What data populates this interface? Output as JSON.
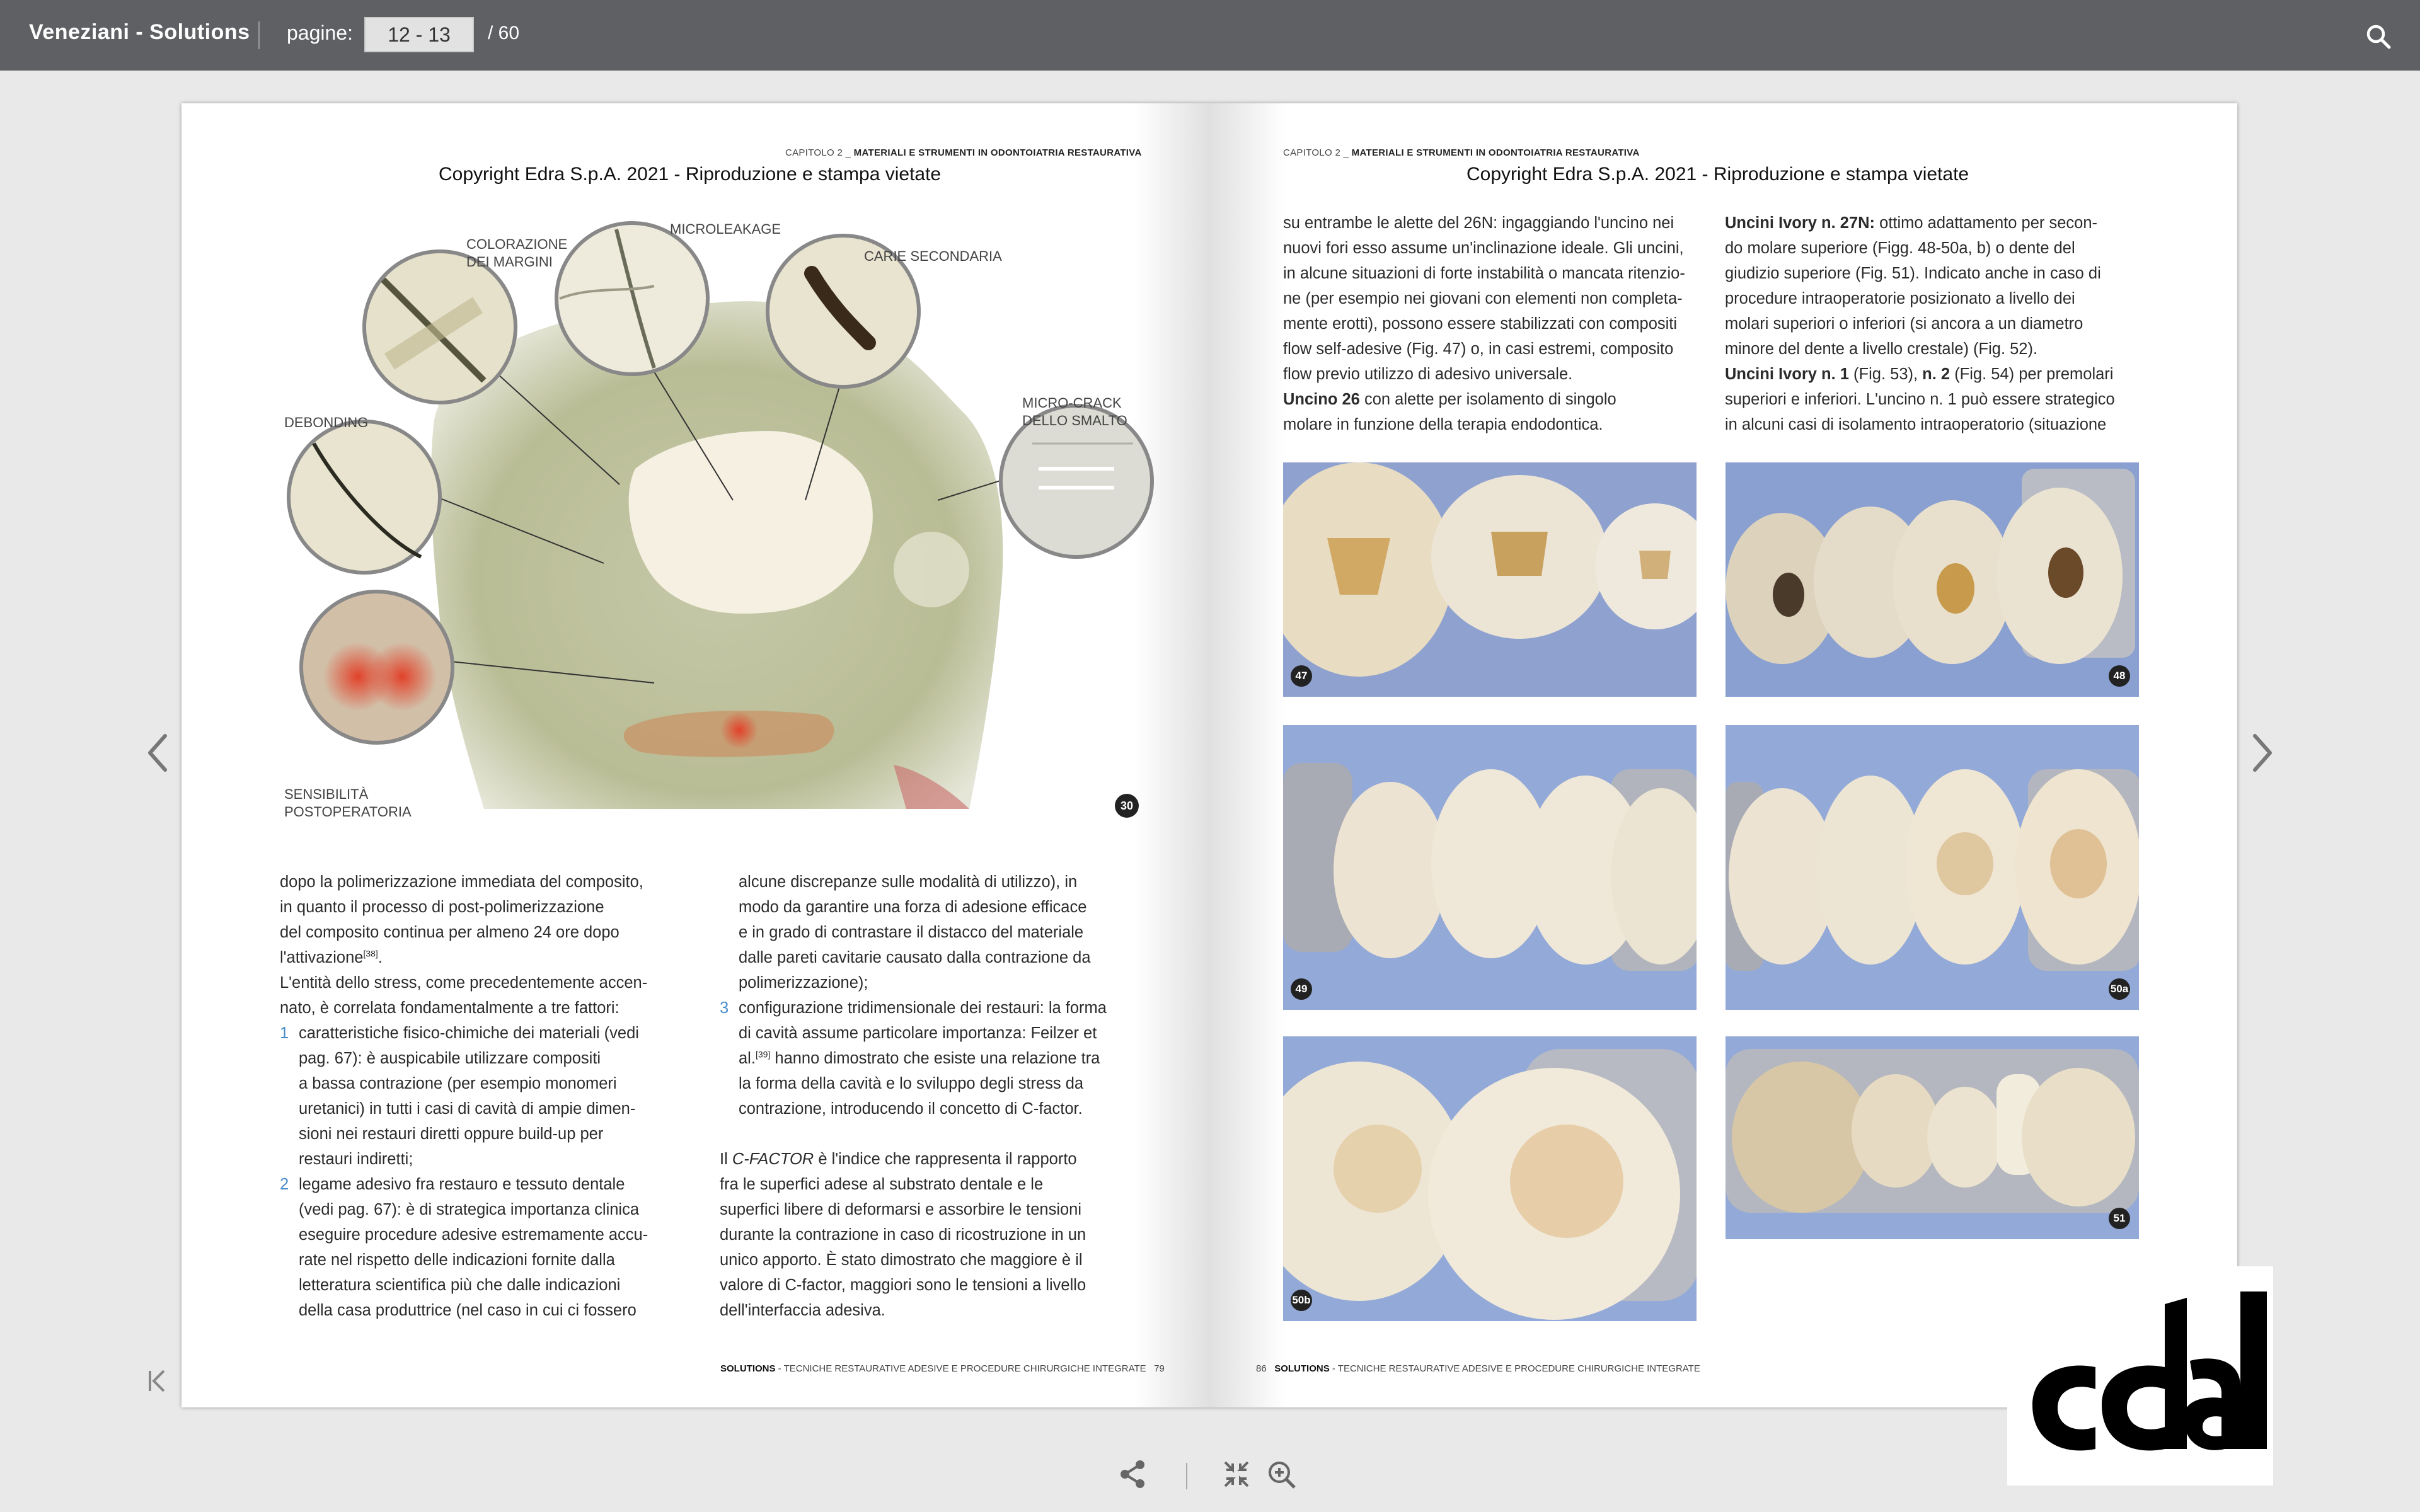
{
  "header": {
    "app_title": "Veneziani - Solutions",
    "pages_label": "pagine:",
    "page_value": "12 - 13",
    "page_total": "/  60"
  },
  "icons": {
    "search": "search-icon",
    "prev": "chevron-left-icon",
    "next": "chevron-right-icon",
    "first": "first-page-icon",
    "share": "share-icon",
    "shrink": "collapse-icon",
    "zoom": "zoom-in-icon"
  },
  "left_page": {
    "running_head_prefix": "CAPITOLO 2 _ ",
    "running_head": "MATERIALI E STRUMENTI IN ODONTOIATRIA RESTAURATIVA",
    "copyright": "Copyright Edra S.p.A. 2021 - Riproduzione e stampa vietate",
    "figure": {
      "labels": {
        "colorazione": "COLORAZIONE\nDEI MARGINI",
        "microleakage": "MICROLEAKAGE",
        "carie": "CARIE SECONDARIA",
        "debonding": "DEBONDING",
        "microcrack": "MICRO-CRACK\nDELLO SMALTO",
        "sensibilita": "SENSIBILITÀ\nPOSTOPERATORIA"
      },
      "number": "30"
    },
    "col1": [
      "dopo la polimerizzazione immediata del composito,",
      "in quanto il processo di post-polimerizzazione",
      "del composito continua per almeno 24 ore dopo",
      "l'attivazione",
      "L'entità dello stress, come precedentemente accen-",
      "nato, è correlata fondamentalmente a tre fattori:"
    ],
    "ref38": "[38]",
    "item1_num": "1",
    "item1": [
      "caratteristiche fisico-chimiche dei materiali (vedi",
      "pag. 67): è auspicabile utilizzare compositi",
      "a bassa contrazione (per esempio monomeri",
      "uretanici) in tutti i casi di cavità di ampie dimen-",
      "sioni nei restauri diretti oppure build-up per",
      "restauri indiretti;"
    ],
    "item2_num": "2",
    "item2": [
      "legame adesivo fra restauro e tessuto dentale",
      "(vedi pag. 67): è di strategica importanza clinica",
      "eseguire procedure adesive estremamente accu-",
      "rate nel rispetto delle indicazioni fornite dalla",
      "letteratura scientifica più che dalle indicazioni",
      "della casa produttrice (nel caso in cui ci fossero"
    ],
    "col2_cont": [
      "alcune discrepanze sulle modalità di utilizzo), in",
      "modo da garantire una forza di adesione efficace",
      "e in grado di contrastare il distacco del materiale",
      "dalle pareti cavitarie causato dalla contrazione da",
      "polimerizzazione);"
    ],
    "item3_num": "3",
    "item3": [
      "configurazione tridimensionale dei restauri: la forma",
      "di cavità assume particolare importanza: Feilzer et",
      "hanno dimostrato che esiste una relazione tra",
      "la forma della cavità e lo sviluppo degli stress da",
      "contrazione, introducendo il concetto di C-factor."
    ],
    "item3_al": "al.",
    "ref39": "[39]",
    "cfactor_pre": "Il ",
    "cfactor_term": "C-FACTOR",
    "cfactor_post": " è l'indice che rappresenta il rapporto",
    "cfactor": [
      "fra le superfici adese al substrato dentale e le",
      "superfici libere di deformarsi e assorbire le tensioni",
      "durante la contrazione in caso di ricostruzione in un",
      "unico apporto. È stato dimostrato che maggiore è il",
      "valore di C-factor, maggiori sono le tensioni a livello",
      "dell'interfaccia adesiva."
    ],
    "footer_brand": "SOLUTIONS",
    "footer_text": " - TECNICHE RESTAURATIVE ADESIVE E PROCEDURE CHIRURGICHE INTEGRATE",
    "footer_page": "79"
  },
  "right_page": {
    "running_head_prefix": "CAPITOLO 2 _ ",
    "running_head": "MATERIALI E STRUMENTI IN ODONTOIATRIA RESTAURATIVA",
    "copyright": "Copyright Edra S.p.A. 2021 - Riproduzione e stampa vietate",
    "col1": [
      "su entrambe le alette del 26N: ingaggiando l'uncino nei",
      "nuovi fori esso assume un'inclinazione ideale. Gli uncini,",
      "in alcune situazioni di forte instabilità o mancata ritenzio-",
      "ne (per esempio nei giovani con elementi non completa-",
      "mente erotti), possono essere stabilizzati con compositi",
      "flow self-adesive (Fig. 47) o, in casi estremi, composito",
      "flow previo utilizzo di adesivo universale."
    ],
    "uncino26_bold": "Uncino 26",
    "uncino26_rest": " con alette per isolamento di singolo",
    "uncino26_line2": "molare in funzione della terapia endodontica.",
    "col2_bold1": "Uncini Ivory n. 27N:",
    "col2_rest1": " ottimo adattamento per secon-",
    "col2_lines1": [
      "do molare superiore (Figg. 48-50a, b) o dente del",
      "giudizio superiore (Fig. 51). Indicato anche in caso di",
      "procedure intraoperatorie posizionato a livello dei",
      "molari superiori o inferiori (si ancora a un diametro",
      "minore del dente a livello crestale) (Fig. 52)."
    ],
    "col2_bold2": "Uncini Ivory n. 1",
    "col2_mid2": " (Fig. 53), ",
    "col2_bold3": "n. 2",
    "col2_rest2": " (Fig. 54) per premolari",
    "col2_lines2": [
      "superiori e inferiori. L'uncino n. 1 può essere strategico",
      "in alcuni casi di isolamento intraoperatorio (situazione"
    ],
    "photos": [
      "47",
      "48",
      "49",
      "50a",
      "50b",
      "51"
    ],
    "footer_page": "86",
    "footer_brand": "SOLUTIONS",
    "footer_text": " - TECNICHE RESTAURATIVE ADESIVE E PROCEDURE CHIRURGICHE INTEGRATE"
  },
  "colors": {
    "topbar": "#5e6063",
    "background": "#e9e9e9",
    "list_number": "#4a8ec9",
    "photo_bg": "#7f96c8"
  }
}
